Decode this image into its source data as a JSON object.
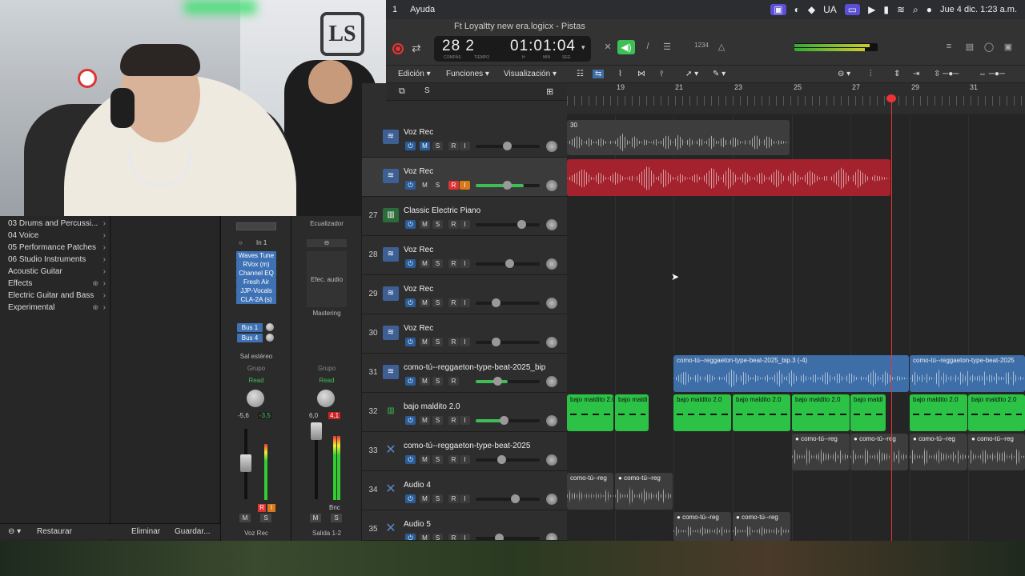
{
  "menubar": {
    "items": [
      "1",
      "Ayuda"
    ],
    "status_icons": [
      "screen-record-icon",
      "activity-icon",
      "diamond-icon",
      "keyboard-layout",
      "screen-mirror-icon",
      "play-icon",
      "battery-icon",
      "wifi-icon",
      "search-icon",
      "siri-icon"
    ],
    "keyboard_layout": "UA",
    "datetime": "Jue 4 dic.  1:23 a.m."
  },
  "window": {
    "title": "Ft Loyaltty new era.logicx - Pistas"
  },
  "lcd": {
    "bar": "28",
    "beat": "2",
    "time": "01:01:04",
    "labels": [
      "COMPÁS",
      "TIEMPO",
      "H",
      "MIN",
      "SEG"
    ]
  },
  "controls": {
    "count_in": "1234"
  },
  "toolbar": {
    "edit": "Edición",
    "functions": "Funciones",
    "view": "Visualización"
  },
  "ruler": {
    "marks": [
      "19",
      "21",
      "23",
      "25",
      "27",
      "29",
      "31"
    ]
  },
  "library": {
    "items": [
      {
        "label": "03 Drums and Percussi...",
        "has_plus": false
      },
      {
        "label": "04 Voice",
        "has_plus": false
      },
      {
        "label": "05 Performance Patches",
        "has_plus": false
      },
      {
        "label": "06 Studio Instruments",
        "has_plus": false
      },
      {
        "label": "Acoustic Guitar",
        "has_plus": false
      },
      {
        "label": "Effects",
        "has_plus": true
      },
      {
        "label": "Electric Guitar and Bass",
        "has_plus": false
      },
      {
        "label": "Experimental",
        "has_plus": true
      }
    ],
    "footer": {
      "restore": "Restaurar",
      "delete": "Eliminar",
      "save": "Guardar..."
    }
  },
  "strip1": {
    "input": "In 1",
    "plugins": [
      "Waves Tune",
      "RVox (m)",
      "Channel EQ",
      "Fresh Air",
      "JJP-Vocals",
      "CLA-2A (s)"
    ],
    "sends": [
      "Bus 1",
      "Bus 4"
    ],
    "output": "Sal estéreo",
    "group": "Grupo",
    "automation": "Read",
    "values": [
      "-5,6",
      "-3,5"
    ],
    "mute": "M",
    "solo": "S",
    "name": "Voz Rec"
  },
  "strip2": {
    "eq_label": "Ecualizador",
    "fx_label": "Efec. audio",
    "mastering": "Mastering",
    "group": "Grupo",
    "automation": "Read",
    "values": [
      "6,0",
      "4,1"
    ],
    "bounce": "Bnc",
    "mute": "M",
    "solo": "S",
    "name": "Salida 1-2"
  },
  "tracks": [
    {
      "num": "",
      "name": "Voz Rec",
      "icon": "waveform-icon"
    },
    {
      "num": "",
      "name": "Voz Rec",
      "icon": "waveform-icon"
    },
    {
      "num": "27",
      "name": "Classic Electric Piano",
      "icon": "piano-icon"
    },
    {
      "num": "28",
      "name": "Voz Rec",
      "icon": "waveform-icon"
    },
    {
      "num": "29",
      "name": "Voz Rec",
      "icon": "waveform-icon"
    },
    {
      "num": "30",
      "name": "Voz Rec",
      "icon": "waveform-icon"
    },
    {
      "num": "31",
      "name": "como-tú--reggaeton-type-beat-2025_bip",
      "icon": "waveform-icon"
    },
    {
      "num": "32",
      "name": "bajo maldito 2.0",
      "icon": "drum-icon"
    },
    {
      "num": "33",
      "name": "como-tú--reggaeton-type-beat-2025",
      "icon": "x-icon"
    },
    {
      "num": "34",
      "name": "Audio 4",
      "icon": "x-icon"
    },
    {
      "num": "35",
      "name": "Audio 5",
      "icon": "x-icon"
    }
  ],
  "button_labels": {
    "mute": "M",
    "solo": "S",
    "record": "R",
    "input": "I"
  },
  "regions": {
    "blue_1": "como-tú--reggaeton-type-beat-2025_bip.3 (-4)",
    "blue_2": "como-tú--reggaeton-type-beat-2025",
    "green_a": "bajo maldito 2.0",
    "green_b": "bajo maldi",
    "green_c": "bajo maldito 2.0",
    "green_d": "bajo maldito 2.0",
    "green_e": "bajo maldito 2.0",
    "green_f": "bajo maldi",
    "green_g": "bajo maldito 2.0",
    "green_h": "bajo maldito 2.0",
    "grey_short": "como-tú--reg",
    "marker": "30"
  },
  "colors": {
    "accent_blue": "#3d6ea8",
    "record_red": "#a3222d",
    "midi_green": "#2cc246"
  }
}
